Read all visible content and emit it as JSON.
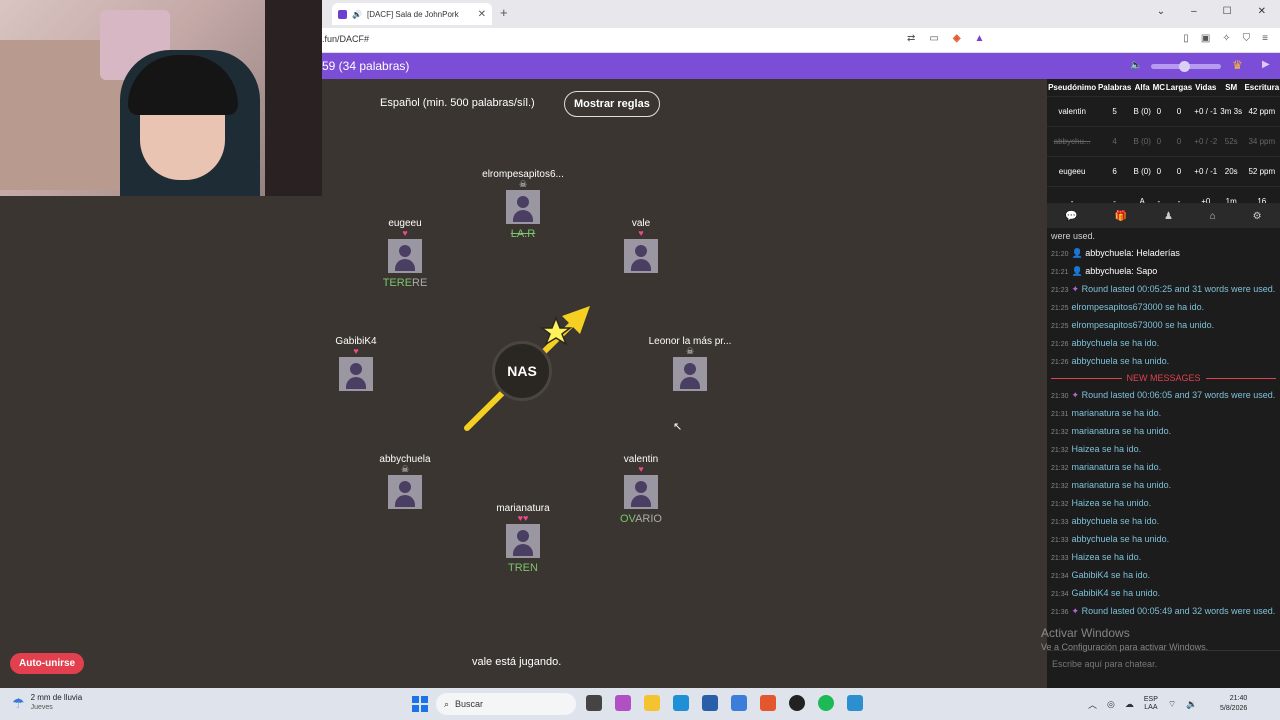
{
  "browser": {
    "tab_title": "[DACF] Sala de JohnPork",
    "tab_close": "✕",
    "new_tab": "+",
    "url": ".fun/DACF#",
    "win_min": "–",
    "win_max": "☐",
    "win_close": "✕",
    "chevron": "⌄"
  },
  "header": {
    "title": "59 (34 palabras)"
  },
  "game": {
    "language_label": "Español (min. 500 palabras/síl.)",
    "rules_button": "Mostrar reglas",
    "syllable": "NAS",
    "status": "vale está jugando.",
    "autojoin": "Auto-unirse",
    "players": [
      {
        "name": "elrompesapitos6...",
        "lives": "☠",
        "word": "LA.R",
        "word_style": "strike"
      },
      {
        "name": "eugeeu",
        "lives": "♥",
        "word_green": "TERE",
        "word_rest": "RE"
      },
      {
        "name": "vale",
        "lives": "♥",
        "word": ""
      },
      {
        "name": "GabibiK4",
        "lives": "♥",
        "word": ""
      },
      {
        "name": "Leonor la más pr...",
        "lives": "☠",
        "word": ""
      },
      {
        "name": "abbychuela",
        "lives": "☠",
        "word": ""
      },
      {
        "name": "valentin",
        "lives": "♥",
        "word_green": "OV",
        "word_rest": "ARIO"
      },
      {
        "name": "marianatura",
        "lives": "♥♥",
        "word": "TREN"
      }
    ]
  },
  "scoreboard": {
    "headers": [
      "Pseudónimo",
      "Palabras",
      "Alfa",
      "MC",
      "Largas",
      "Vidas",
      "SM",
      "Escritura"
    ],
    "rows": [
      {
        "name": "valentin",
        "words": "5",
        "alpha": "B (0)",
        "mc": "0",
        "long": "0",
        "lives": "+0 / -1",
        "sm": "3m 3s",
        "speed": "42 ppm"
      },
      {
        "name": "abbychu...",
        "words": "4",
        "alpha": "B (0)",
        "mc": "0",
        "long": "0",
        "lives": "+0 / -2",
        "sm": "52s",
        "speed": "34 ppm"
      },
      {
        "name": "eugeeu",
        "words": "6",
        "alpha": "B (0)",
        "mc": "0",
        "long": "0",
        "lives": "+0 / -1",
        "sm": "20s",
        "speed": "52 ppm"
      },
      {
        "name": "-",
        "words": "-",
        "alpha": "A",
        "mc": "-",
        "long": "-",
        "lives": "+0",
        "sm": "1m",
        "speed": "16"
      }
    ]
  },
  "chat": {
    "first_line": "were used.",
    "messages_before": [
      {
        "time": "21:20",
        "user": "abbychuela",
        "text": ": Heladerías"
      },
      {
        "time": "21:21",
        "user": "abbychuela",
        "text": ": Sapo"
      },
      {
        "time": "21:23",
        "text": "Round lasted 00:05:25 and 31 words were used."
      },
      {
        "time": "21:25",
        "text": "elrompesapitos673000 se ha ido."
      },
      {
        "time": "21:25",
        "text": "elrompesapitos673000 se ha unido."
      },
      {
        "time": "21:26",
        "text": "abbychuela se ha ido."
      },
      {
        "time": "21:26",
        "text": "abbychuela se ha unido."
      }
    ],
    "new_messages_label": "NEW MESSAGES",
    "messages_after": [
      {
        "time": "21:30",
        "text": "Round lasted 00:06:05 and 37 words were used."
      },
      {
        "time": "21:31",
        "text": "marianatura se ha ido."
      },
      {
        "time": "21:32",
        "text": "marianatura se ha unido."
      },
      {
        "time": "21:32",
        "text": "Haizea se ha ido."
      },
      {
        "time": "21:32",
        "text": "marianatura se ha ido."
      },
      {
        "time": "21:32",
        "text": "marianatura se ha unido."
      },
      {
        "time": "21:32",
        "text": "Haizea se ha unido."
      },
      {
        "time": "21:33",
        "text": "abbychuela se ha ido."
      },
      {
        "time": "21:33",
        "text": "abbychuela se ha unido."
      },
      {
        "time": "21:33",
        "text": "Haizea se ha ido."
      },
      {
        "time": "21:34",
        "text": "GabibiK4 se ha ido."
      },
      {
        "time": "21:34",
        "text": "GabibiK4 se ha unido."
      },
      {
        "time": "21:36",
        "text": "Round lasted 00:05:49 and 32 words were used."
      }
    ],
    "placeholder": "Escribe aquí para chatear.",
    "activate_title": "Activar Windows",
    "activate_sub": "Ve a Configuración para activar Windows."
  },
  "taskbar": {
    "weather": "2 mm de lluvia",
    "weather_day": "Jueves",
    "search": "Buscar",
    "lang1": "ESP",
    "lang2": "LAA",
    "time": "21:40",
    "date": "5/8/2026"
  },
  "colors": {
    "accent": "#7c4dd6",
    "danger": "#e2404e",
    "word_green": "#7cc46f"
  }
}
